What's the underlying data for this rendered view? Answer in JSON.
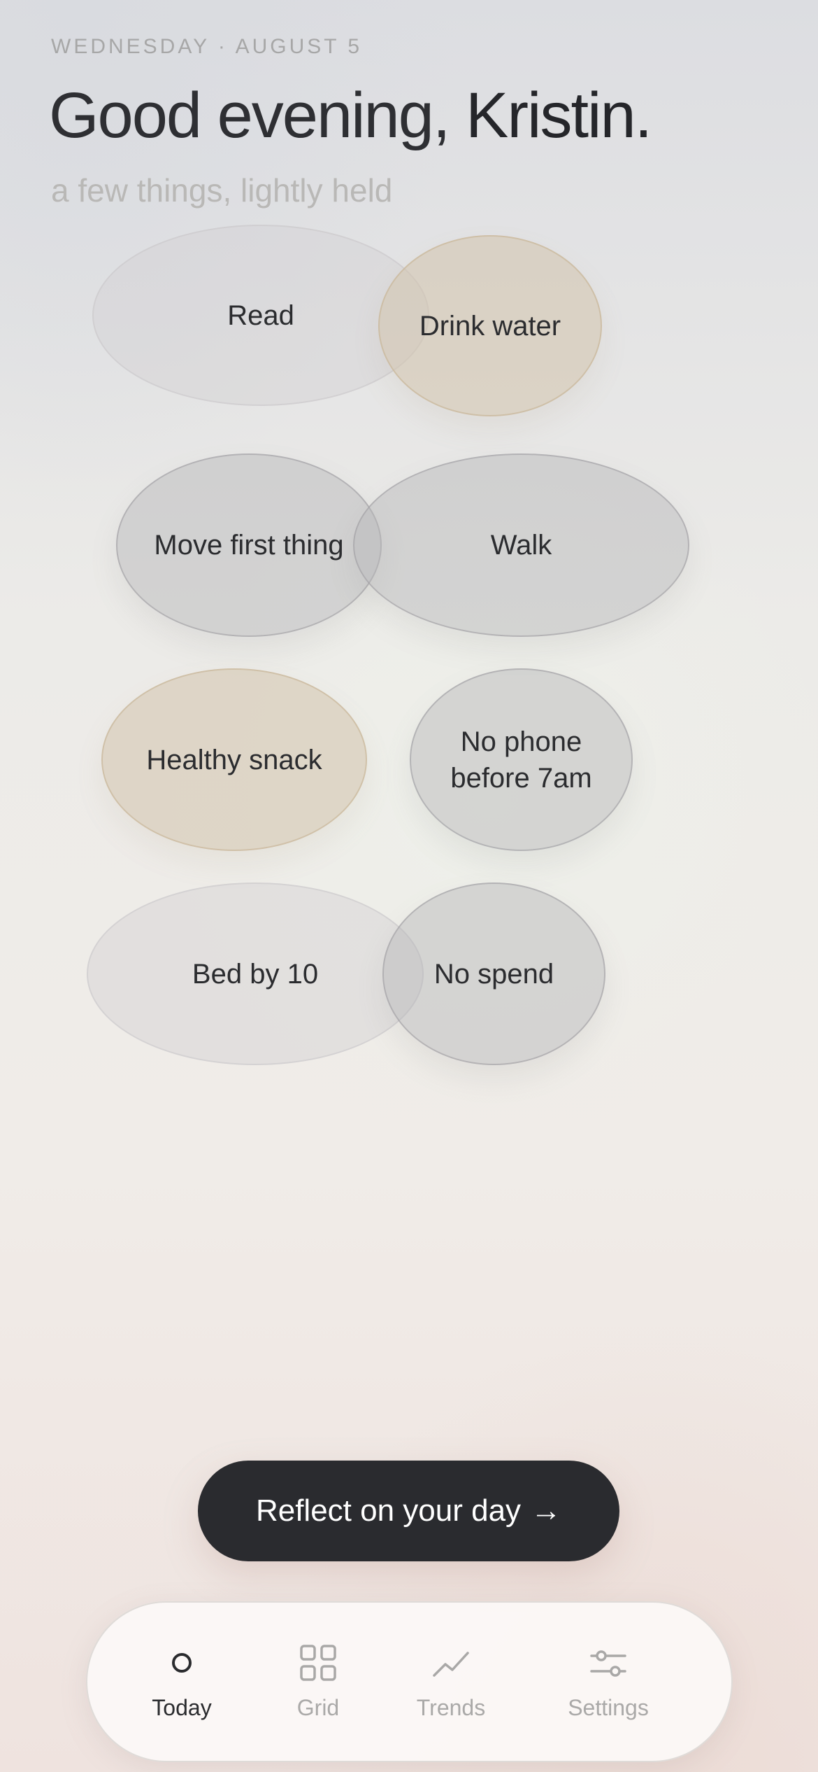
{
  "header": {
    "date": "WEDNESDAY · AUGUST 5",
    "greeting": "Good evening,",
    "name": "Kristin.",
    "subtitle": "a few things, lightly held"
  },
  "habits": [
    {
      "label": "Read",
      "state": "not-started"
    },
    {
      "label": "Drink water",
      "state": "partial"
    },
    {
      "label": "Move first thing",
      "state": "done"
    },
    {
      "label": "Walk",
      "state": "done"
    },
    {
      "label": "Healthy snack",
      "state": "partial"
    },
    {
      "label": "No phone before 7am",
      "state": "done"
    },
    {
      "label": "Bed by 10",
      "state": "not-started"
    },
    {
      "label": "No spend",
      "state": "done"
    }
  ],
  "reflect_button": {
    "label": "Reflect on your day",
    "arrow": "→"
  },
  "tabbar": {
    "tabs": [
      {
        "label": "Today",
        "icon": "circle-icon",
        "active": true
      },
      {
        "label": "Grid",
        "icon": "grid-icon",
        "active": false
      },
      {
        "label": "Trends",
        "icon": "trend-line-icon",
        "active": false
      },
      {
        "label": "Settings",
        "icon": "sliders-icon",
        "active": false
      }
    ]
  },
  "colors": {
    "text_primary": "#2a2b2e",
    "text_muted": "#a7a7a7",
    "button_dark": "#2a2b2f",
    "blob_grey": "#b4b3b6",
    "blob_tan": "#d2c3ac",
    "blob_light": "#d2d0d2"
  }
}
